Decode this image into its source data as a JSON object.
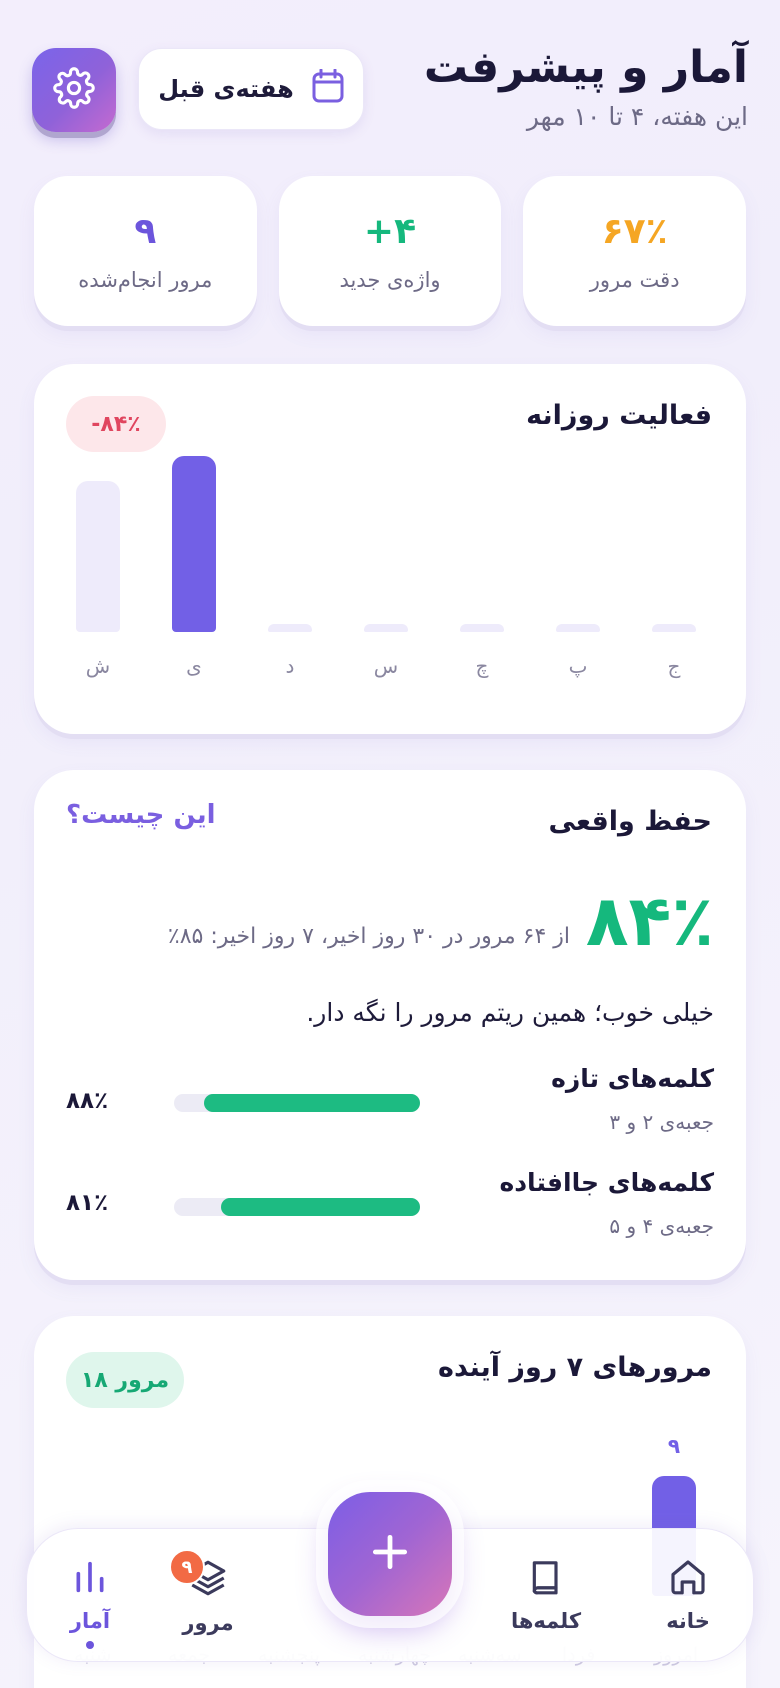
{
  "header": {
    "title": "آمار و پیشرفت",
    "subtitle": "این هفته، ۴ تا ۱۰ مهر",
    "prev_week_label": "هفته‌ی قبل"
  },
  "stats": [
    {
      "value": "۶۷٪",
      "label": "دقت مرور",
      "color": "#f5a623"
    },
    {
      "value": "+۴",
      "label": "واژه‌ی جدید",
      "color": "#15b87d"
    },
    {
      "value": "۹",
      "label": "مرور انجام‌شده",
      "color": "#6c55dc"
    }
  ],
  "daily": {
    "title": "فعالیت روزانه",
    "change": "-۸۴٪"
  },
  "chart_data": {
    "type": "bar",
    "categories": [
      "ش",
      "ی",
      "د",
      "س",
      "چ",
      "پ",
      "ج"
    ],
    "values": [
      0.86,
      1.0,
      0.04,
      0.04,
      0.04,
      0.04,
      0.04
    ],
    "highlight_index": 1,
    "colors": {
      "highlight": "#7260e6",
      "muted": "#eeebfb"
    }
  },
  "retention": {
    "title": "حفظ واقعی",
    "link": "این چیست؟",
    "value": "۸۴٪",
    "detail": "از ۶۴ مرور در ۳۰ روز اخیر، ۷ روز اخیر: ۸۵٪",
    "message": "خیلی خوب؛ همین ریتم مرور را نگه دار.",
    "rows": [
      {
        "title": "کلمه‌های تازه",
        "subtitle": "جعبه‌ی ۲ و ۳",
        "percent": "۸۸٪",
        "fraction": 0.88
      },
      {
        "title": "کلمه‌های جاافتاده",
        "subtitle": "جعبه‌ی ۴ و ۵",
        "percent": "۸۱٪",
        "fraction": 0.81
      }
    ]
  },
  "upcoming": {
    "title": "مرورهای ۷ روز آینده",
    "badge": "۱۸ مرور",
    "first_value": "۹",
    "days": [
      "امروز",
      "فردا",
      "سه‌شنبه",
      "چهارشنبه",
      "پنجشنبه",
      "جمعه",
      "شنبه"
    ]
  },
  "nav": {
    "home": "خانه",
    "words": "کلمه‌ها",
    "review": "مرور",
    "review_badge": "۹",
    "stats": "آمار"
  }
}
